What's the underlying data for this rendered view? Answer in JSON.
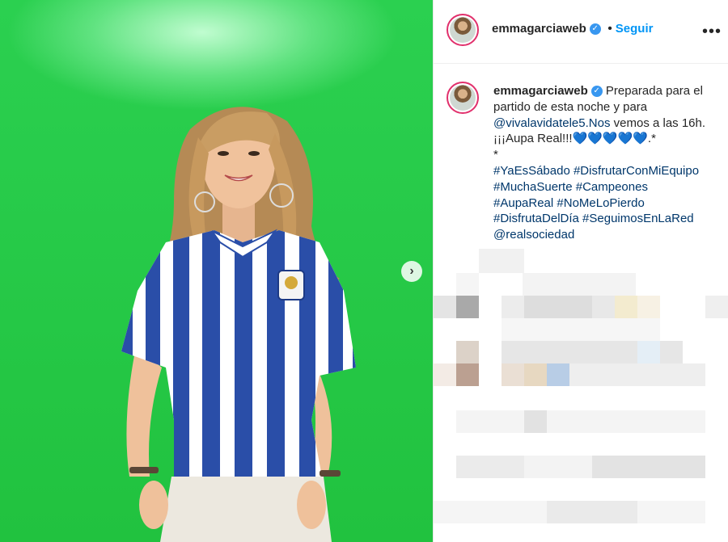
{
  "post": {
    "username": "emmagarciaweb",
    "follow_label": "Seguir",
    "separator": "•",
    "verified_icon": "verified-badge-icon",
    "more_icon": "more-options-icon",
    "more_label": "•••"
  },
  "caption": {
    "username": "emmagarciaweb",
    "text_1": "Preparada para el partido de esta noche y para",
    "mention_1": "@vivalavidatele5.Nos",
    "text_2": "vemos a las 16h. ¡¡¡Aupa Real!!!💙💙💙💙💙.*",
    "text_3": "*",
    "hashtags_1": "#YaEsSábado #DisfrutarConMiEquipo",
    "hashtags_2": "#MuchaSuerte #Campeones",
    "hashtags_3": "#AupaReal #NoMeLoPierdo",
    "hashtags_4": "#DisfrutaDelDía #SeguimosEnLaRed",
    "mention_2": "@realsociedad"
  },
  "media": {
    "next_icon": "chevron-right-icon",
    "next_label": "›",
    "colors": {
      "green_screen": "#22c742",
      "stripe_blue": "#2a4ea8"
    }
  }
}
